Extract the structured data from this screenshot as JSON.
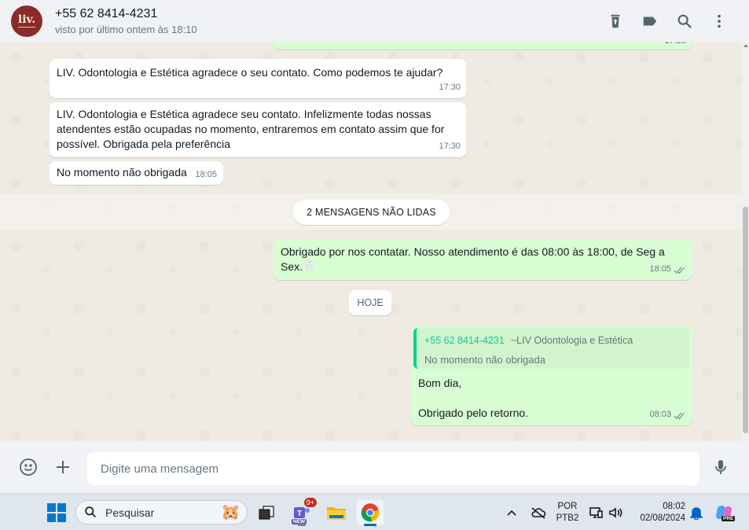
{
  "header": {
    "avatar_text": "liv.",
    "contact_name": "+55 62 8414-4231",
    "contact_status": "visto por último ontem às 18:10"
  },
  "messages": {
    "top_partial_time": "17:29",
    "m1": {
      "text": "LIV. Odontologia e Estética agradece o seu contato. Como podemos te ajudar?",
      "time": "17:30"
    },
    "m2": {
      "line1": "LIV. Odontologia e Estética agradece seu contato. Infelizmente todas nossas",
      "line2": "atendentes estão ocupadas no momento, entraremos em contato assim que for",
      "line3": "possível. Obrigada pela preferência",
      "time": "17:30"
    },
    "m3": {
      "text": "No momento não obrigada",
      "time": "18:05"
    },
    "unread_label": "2 MENSAGENS NÃO LIDAS",
    "m4": {
      "line1": "Obrigado por nos contatar. Nosso atendimento é das 08:00 às 18:00, de Seg a",
      "line2": "Sex.",
      "emoji": "🦷",
      "time": "18:05"
    },
    "today_label": "HOJE",
    "m5": {
      "quote_author": "+55 62 8414-4231",
      "quote_sub": "~LIV Odontologia e Estética",
      "quote_text": "No momento não obrigada",
      "line1": "Bom dia,",
      "line2": "Obrigado pelo retorno.",
      "time": "08:03"
    }
  },
  "composer": {
    "placeholder": "Digite uma mensagem"
  },
  "taskbar": {
    "search_placeholder": "Pesquisar",
    "teams_badge": "9+",
    "teams_new": "NEW",
    "lang_line1": "POR",
    "lang_line2": "PTB2",
    "time": "08:02",
    "date": "02/08/2024",
    "copilot_badge": "PRE"
  },
  "colors": {
    "accent": "#06cf9c",
    "outgoing_bubble": "#d9fdd3",
    "incoming_bubble": "#ffffff",
    "chat_bg": "#efeae2",
    "header_bg": "#f0f2f5",
    "avatar_bg": "#8a2a2a"
  },
  "icons": {
    "header": [
      "archive-icon",
      "label-icon",
      "search-icon",
      "menu-icon"
    ],
    "composer": [
      "emoji-icon",
      "plus-icon",
      "mic-icon"
    ]
  }
}
